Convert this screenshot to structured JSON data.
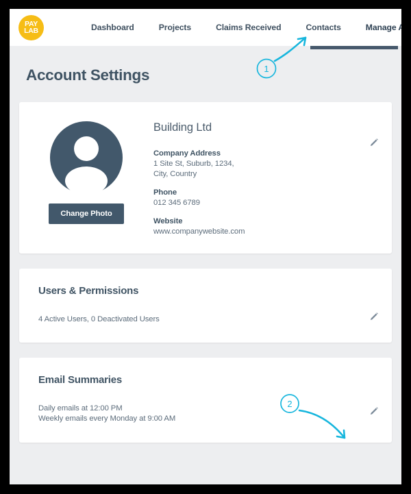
{
  "app": {
    "logo": {
      "name": "paylab-logo",
      "line1": "PAY",
      "line2": "LAB",
      "color": "#f6bd16"
    },
    "nav": {
      "items": [
        {
          "label": "Dashboard",
          "active": false
        },
        {
          "label": "Projects",
          "active": false
        },
        {
          "label": "Claims Received",
          "active": false
        },
        {
          "label": "Contacts",
          "active": false
        },
        {
          "label": "Manage Account",
          "active": true
        }
      ],
      "active_indicator_color": "#47596c"
    }
  },
  "page": {
    "title": "Account Settings",
    "background": "#edeef0"
  },
  "profile_card": {
    "avatar": {
      "icon": "user-avatar-icon",
      "color": "#42586b"
    },
    "change_photo_label": "Change Photo",
    "company_name": "Building Ltd",
    "fields": [
      {
        "label": "Company Address",
        "value": "1 Site St, Suburb, 1234,\nCity, Country"
      },
      {
        "label": "Phone",
        "value": "012 345 6789"
      },
      {
        "label": "Website",
        "value": "www.companywebsite.com"
      }
    ],
    "edit_icon": "pencil-icon"
  },
  "users_card": {
    "title": "Users & Permissions",
    "summary": "4 Active Users, 0 Deactivated Users",
    "edit_icon": "pencil-icon"
  },
  "emails_card": {
    "title": "Email Summaries",
    "line1": "Daily emails at 12:00 PM",
    "line2": "Weekly emails every Monday at 9:00 AM",
    "edit_icon": "pencil-icon"
  },
  "annotations": {
    "color": "#17b6dd",
    "markers": [
      {
        "number": "1",
        "target": "manage-account-nav-item"
      },
      {
        "number": "2",
        "target": "email-summaries-edit-icon"
      }
    ]
  }
}
